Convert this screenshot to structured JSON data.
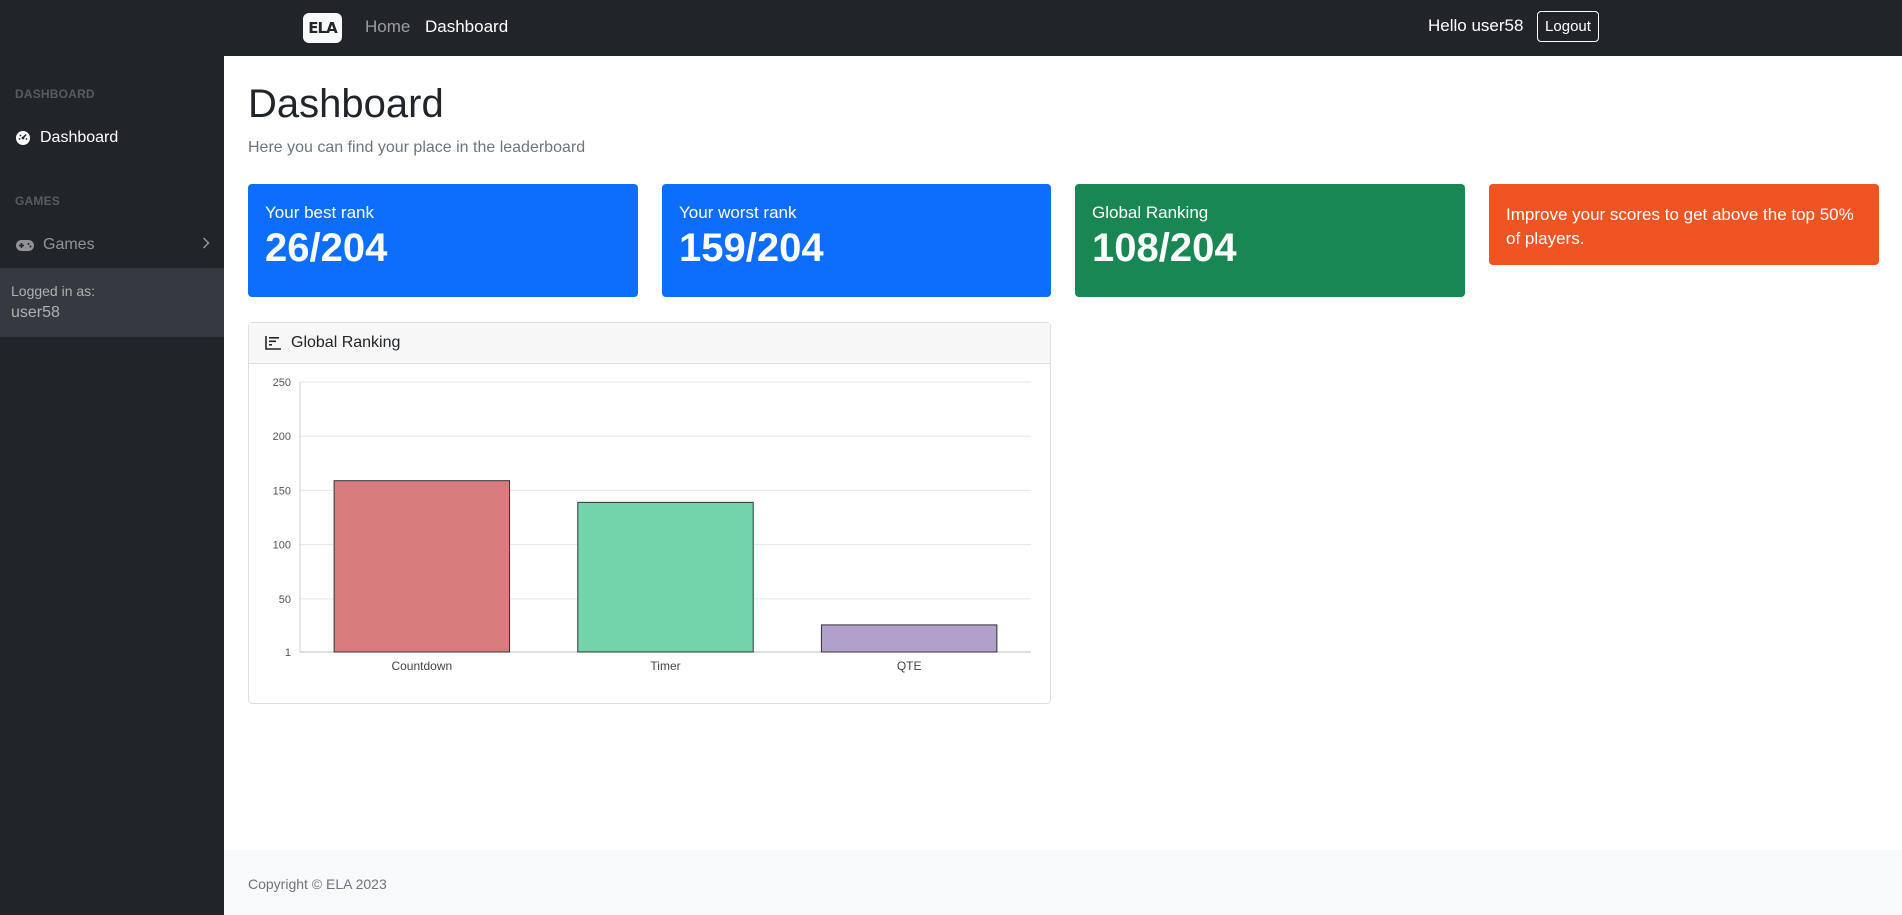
{
  "nav": {
    "logo_text": "ELA",
    "links": [
      "Home",
      "Dashboard"
    ],
    "greeting": "Hello user58",
    "logout_label": "Logout"
  },
  "sidebar": {
    "sections": [
      {
        "heading": "DASHBOARD",
        "items": [
          {
            "label": "Dashboard",
            "icon": "gauge-icon"
          }
        ]
      },
      {
        "heading": "GAMES",
        "items": [
          {
            "label": "Games",
            "icon": "gamepad-icon"
          }
        ]
      }
    ],
    "footer": {
      "label": "Logged in as:",
      "user": "user58"
    }
  },
  "main": {
    "title": "Dashboard",
    "subtitle": "Here you can find your place in the leaderboard",
    "cards": [
      {
        "label": "Your best rank",
        "value": "26/204",
        "color": "#0d6efd"
      },
      {
        "label": "Your worst rank",
        "value": "159/204",
        "color": "#0d6efd"
      },
      {
        "label": "Global Ranking",
        "value": "108/204",
        "color": "#198754"
      },
      {
        "label": "Improve your scores to get above the top 50% of players.",
        "color": "#f05423"
      }
    ],
    "chart_title": "Global Ranking",
    "chart_icon": "bar-chart-icon"
  },
  "chart_data": {
    "type": "bar",
    "categories": [
      "Countdown",
      "Timer",
      "QTE"
    ],
    "values": [
      159,
      139,
      26
    ],
    "colors": [
      "#d97c7e",
      "#72d4a8",
      "#b19fcc"
    ],
    "y_ticks": [
      1,
      50,
      100,
      150,
      200,
      250
    ],
    "ylim": [
      1,
      250
    ],
    "grid": true
  },
  "footer": {
    "text": "Copyright © ELA 2023"
  }
}
